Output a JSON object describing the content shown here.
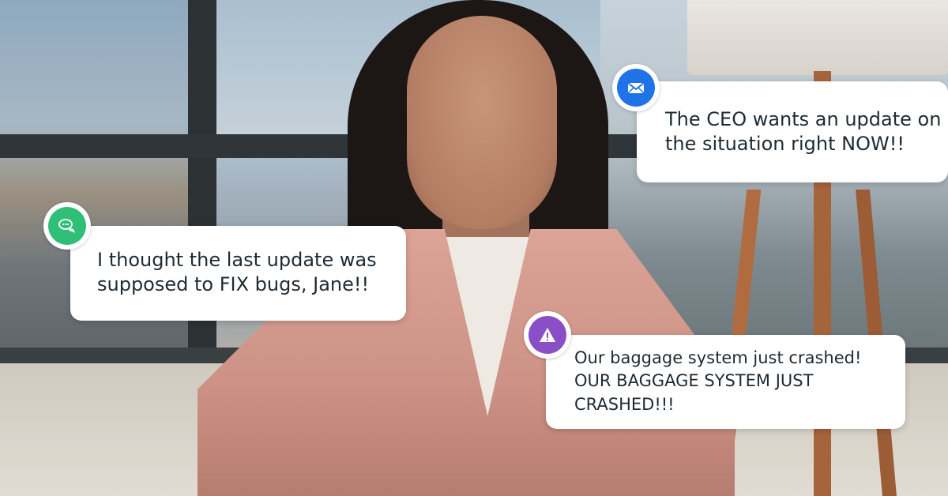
{
  "notifications": [
    {
      "icon": "envelope-icon",
      "color": "#1f73e6",
      "text": "The CEO wants an update on the situation right NOW!!"
    },
    {
      "icon": "chat-bubbles-icon",
      "color": "#2fbf77",
      "text": "I thought the last update was supposed to FIX bugs, Jane!!"
    },
    {
      "icon": "warning-triangle-icon",
      "color": "#8a4fc7",
      "text": "Our baggage system just crashed! OUR BAGGAGE SYSTEM JUST CRASHED!!!"
    }
  ]
}
